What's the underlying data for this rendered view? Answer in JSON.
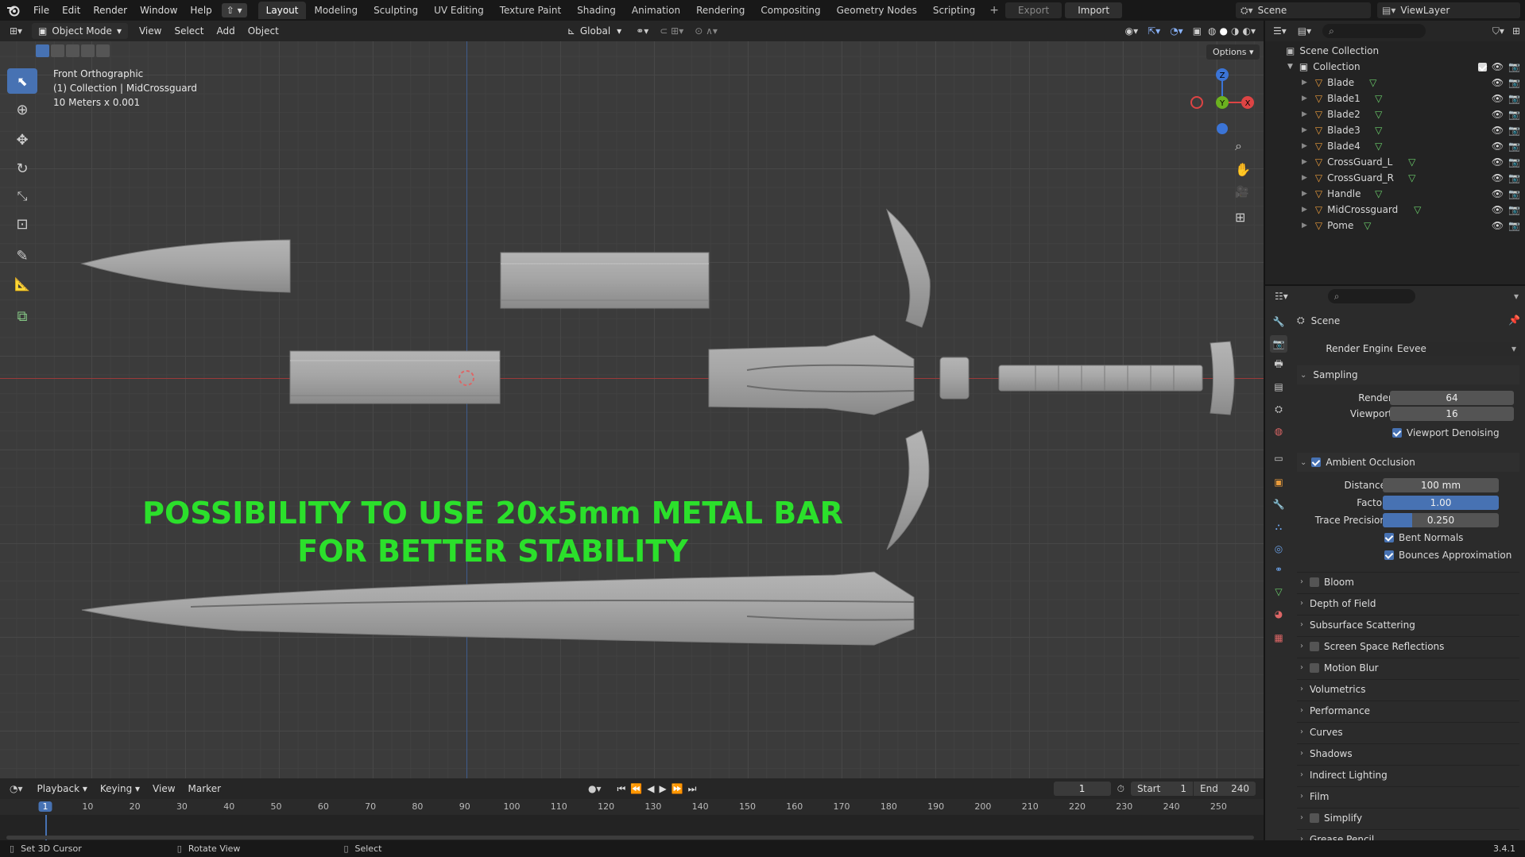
{
  "topbar": {
    "menus": [
      "File",
      "Edit",
      "Render",
      "Window",
      "Help"
    ],
    "workspaces": [
      "Layout",
      "Modeling",
      "Sculpting",
      "UV Editing",
      "Texture Paint",
      "Shading",
      "Animation",
      "Rendering",
      "Compositing",
      "Geometry Nodes",
      "Scripting"
    ],
    "active_workspace": "Layout",
    "export_label": "Export",
    "import_label": "Import",
    "scene_name": "Scene",
    "view_layer": "ViewLayer"
  },
  "viewport_header": {
    "mode": "Object Mode",
    "menus": [
      "View",
      "Select",
      "Add",
      "Object"
    ],
    "transform_orientation": "Global",
    "options_label": "Options"
  },
  "viewport": {
    "view_name": "Front Orthographic",
    "collection_info": "(1) Collection | MidCrossguard",
    "scale_info": "10 Meters x 0.001",
    "caption_line1": "POSSIBILITY TO USE 20x5mm METAL BAR",
    "caption_line2": "FOR BETTER STABILITY",
    "caption_color": "#2be02b",
    "gizmo_axes": {
      "z": "Z",
      "y": "Y",
      "x": "X"
    }
  },
  "outliner": {
    "scene_collection": "Scene Collection",
    "collection": "Collection",
    "objects": [
      "Blade",
      "Blade1",
      "Blade2",
      "Blade3",
      "Blade4",
      "CrossGuard_L",
      "CrossGuard_R",
      "Handle",
      "MidCrossguard",
      "Pome"
    ],
    "active_object": "MidCrossguard"
  },
  "properties": {
    "context": "Scene",
    "render_engine_label": "Render Engine",
    "render_engine": "Eevee",
    "sampling": {
      "title": "Sampling",
      "render_label": "Render",
      "render": "64",
      "viewport_label": "Viewport",
      "viewport": "16",
      "denoise_label": "Viewport Denoising"
    },
    "ao": {
      "title": "Ambient Occlusion",
      "distance_label": "Distance",
      "distance": "100 mm",
      "factor_label": "Factor",
      "factor": "1.00",
      "factor_fill": 1.0,
      "trace_label": "Trace Precision",
      "trace": "0.250",
      "trace_fill": 0.25,
      "bent_label": "Bent Normals",
      "bounces_label": "Bounces Approximation"
    },
    "panels": [
      {
        "label": "Bloom",
        "checkbox": true
      },
      {
        "label": "Depth of Field",
        "checkbox": false
      },
      {
        "label": "Subsurface Scattering",
        "checkbox": false
      },
      {
        "label": "Screen Space Reflections",
        "checkbox": true
      },
      {
        "label": "Motion Blur",
        "checkbox": true
      },
      {
        "label": "Volumetrics",
        "checkbox": false
      },
      {
        "label": "Performance",
        "checkbox": false
      },
      {
        "label": "Curves",
        "checkbox": false
      },
      {
        "label": "Shadows",
        "checkbox": false
      },
      {
        "label": "Indirect Lighting",
        "checkbox": false
      },
      {
        "label": "Film",
        "checkbox": false
      },
      {
        "label": "Simplify",
        "checkbox": true
      },
      {
        "label": "Grease Pencil",
        "checkbox": false
      }
    ]
  },
  "timeline": {
    "menus": [
      "Playback",
      "Keying",
      "View",
      "Marker"
    ],
    "current_frame": "1",
    "start_label": "Start",
    "start": "1",
    "end_label": "End",
    "end": "240",
    "ruler": [
      "1",
      "10",
      "20",
      "30",
      "40",
      "50",
      "60",
      "70",
      "80",
      "90",
      "100",
      "110",
      "120",
      "130",
      "140",
      "150",
      "160",
      "170",
      "180",
      "190",
      "200",
      "210",
      "220",
      "230",
      "240",
      "250"
    ]
  },
  "statusbar": {
    "hint1": "Set 3D Cursor",
    "hint2": "Rotate View",
    "hint3": "Select",
    "version": "3.4.1"
  }
}
